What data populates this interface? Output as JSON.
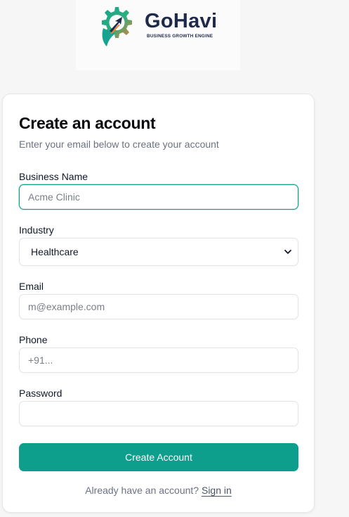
{
  "brand": {
    "name": "GoHavi",
    "tagline": "BUSINESS GROWTH ENGINE"
  },
  "form": {
    "title": "Create an account",
    "subtitle": "Enter your email below to create your account",
    "business_name": {
      "label": "Business Name",
      "value": "",
      "placeholder": "Acme Clinic"
    },
    "industry": {
      "label": "Industry",
      "selected": "Healthcare"
    },
    "email": {
      "label": "Email",
      "value": "",
      "placeholder": "m@example.com"
    },
    "phone": {
      "label": "Phone",
      "value": "",
      "placeholder": "+91..."
    },
    "password": {
      "label": "Password",
      "value": "",
      "placeholder": ""
    },
    "submit_label": "Create Account",
    "footer_text": "Already have an account?",
    "signin_label": "Sign in"
  },
  "colors": {
    "accent": "#0d9e8c",
    "logo_orange": "#f47a2c",
    "logo_teal": "#16a390",
    "logo_text": "#1e2a4a"
  }
}
